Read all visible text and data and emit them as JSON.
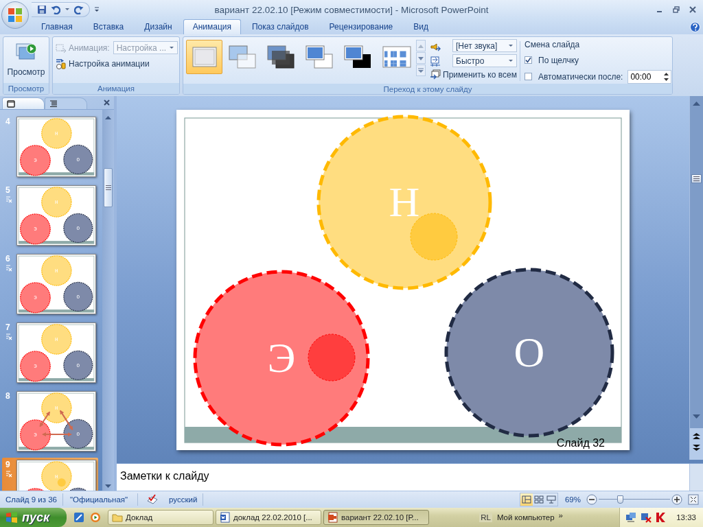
{
  "window": {
    "title": "вариант 22.02.10 [Режим совместимости] - Microsoft PowerPoint"
  },
  "ribbon_tabs": [
    {
      "label": "Главная",
      "selected": false
    },
    {
      "label": "Вставка",
      "selected": false
    },
    {
      "label": "Дизайн",
      "selected": false
    },
    {
      "label": "Анимация",
      "selected": true
    },
    {
      "label": "Показ слайдов",
      "selected": false
    },
    {
      "label": "Рецензирование",
      "selected": false
    },
    {
      "label": "Вид",
      "selected": false
    }
  ],
  "preview_group": {
    "button": "Просмотр",
    "label": "Просмотр"
  },
  "animation_group": {
    "field_label": "Анимация:",
    "field_value": "Настройка ...",
    "disabled": true,
    "custom_button": "Настройка анимации",
    "label": "Анимация"
  },
  "transition_group": {
    "styles": [
      {
        "kind": "none",
        "selected": true
      },
      {
        "kind": "fade",
        "selected": false
      },
      {
        "kind": "dark",
        "selected": false
      },
      {
        "kind": "cut",
        "selected": false
      },
      {
        "kind": "black",
        "selected": false
      },
      {
        "kind": "dissolve",
        "selected": false
      }
    ],
    "sound": "[Нет звука]",
    "speed": "Быстро",
    "apply_all": "Применить ко всем",
    "label": "Переход к этому слайду"
  },
  "advance_group": {
    "title": "Смена слайда",
    "options": [
      {
        "label": "По щелчку",
        "checked": true
      },
      {
        "label": "Автоматически после:",
        "checked": false
      }
    ],
    "time": "00:00"
  },
  "panel_tabs": [
    {
      "kind": "slides",
      "selected": true
    },
    {
      "kind": "outline",
      "selected": false
    }
  ],
  "thumbnails": [
    {
      "number": "4",
      "animated": false,
      "kind": "plain",
      "selected": false,
      "labels": [
        "Н",
        "Э",
        "О"
      ]
    },
    {
      "number": "5",
      "animated": true,
      "kind": "plain",
      "selected": false,
      "labels": [
        "Н",
        "Э",
        "О"
      ]
    },
    {
      "number": "6",
      "animated": true,
      "kind": "plain",
      "selected": false,
      "labels": [
        "Н",
        "Э",
        "О"
      ]
    },
    {
      "number": "7",
      "animated": true,
      "kind": "plain",
      "selected": false,
      "labels": [
        "Н",
        "Э",
        "О"
      ]
    },
    {
      "number": "8",
      "animated": false,
      "kind": "arrows",
      "selected": false,
      "labels": [
        "Н",
        "Э",
        "О"
      ]
    },
    {
      "number": "9",
      "animated": true,
      "kind": "dot",
      "selected": true,
      "labels": [
        "Н"
      ]
    }
  ],
  "slide": {
    "shapes": [
      {
        "label": "Н",
        "color": "#ffdd80",
        "dot": true
      },
      {
        "label": "Э",
        "color": "#ff7b7b",
        "dot": true
      },
      {
        "label": "О",
        "color": "#7e8aa9",
        "dot": false
      }
    ],
    "footer": "Слайд  32"
  },
  "notes": {
    "placeholder": "Заметки к слайду"
  },
  "status_bar": {
    "slide": "Слайд 9 из 36",
    "theme": "\"Официальная\"",
    "language": "русский",
    "views": [
      {
        "kind": "normal",
        "selected": true
      },
      {
        "kind": "sorter",
        "selected": false
      },
      {
        "kind": "show",
        "selected": false
      }
    ],
    "zoom": {
      "reading": "69%",
      "level": 0.3
    }
  },
  "taskbar": {
    "start": "пуск",
    "tasks": [
      {
        "label": "Доклад",
        "kind": "folder",
        "selected": false
      },
      {
        "label": "доклад 22.02.2010 [...",
        "kind": "word",
        "selected": false
      },
      {
        "label": "вариант 22.02.10 [Р...",
        "kind": "powerpoint",
        "selected": true
      }
    ],
    "language": "RL",
    "toolbar": "Мой компьютер",
    "more": "»",
    "clock": "13:33"
  }
}
